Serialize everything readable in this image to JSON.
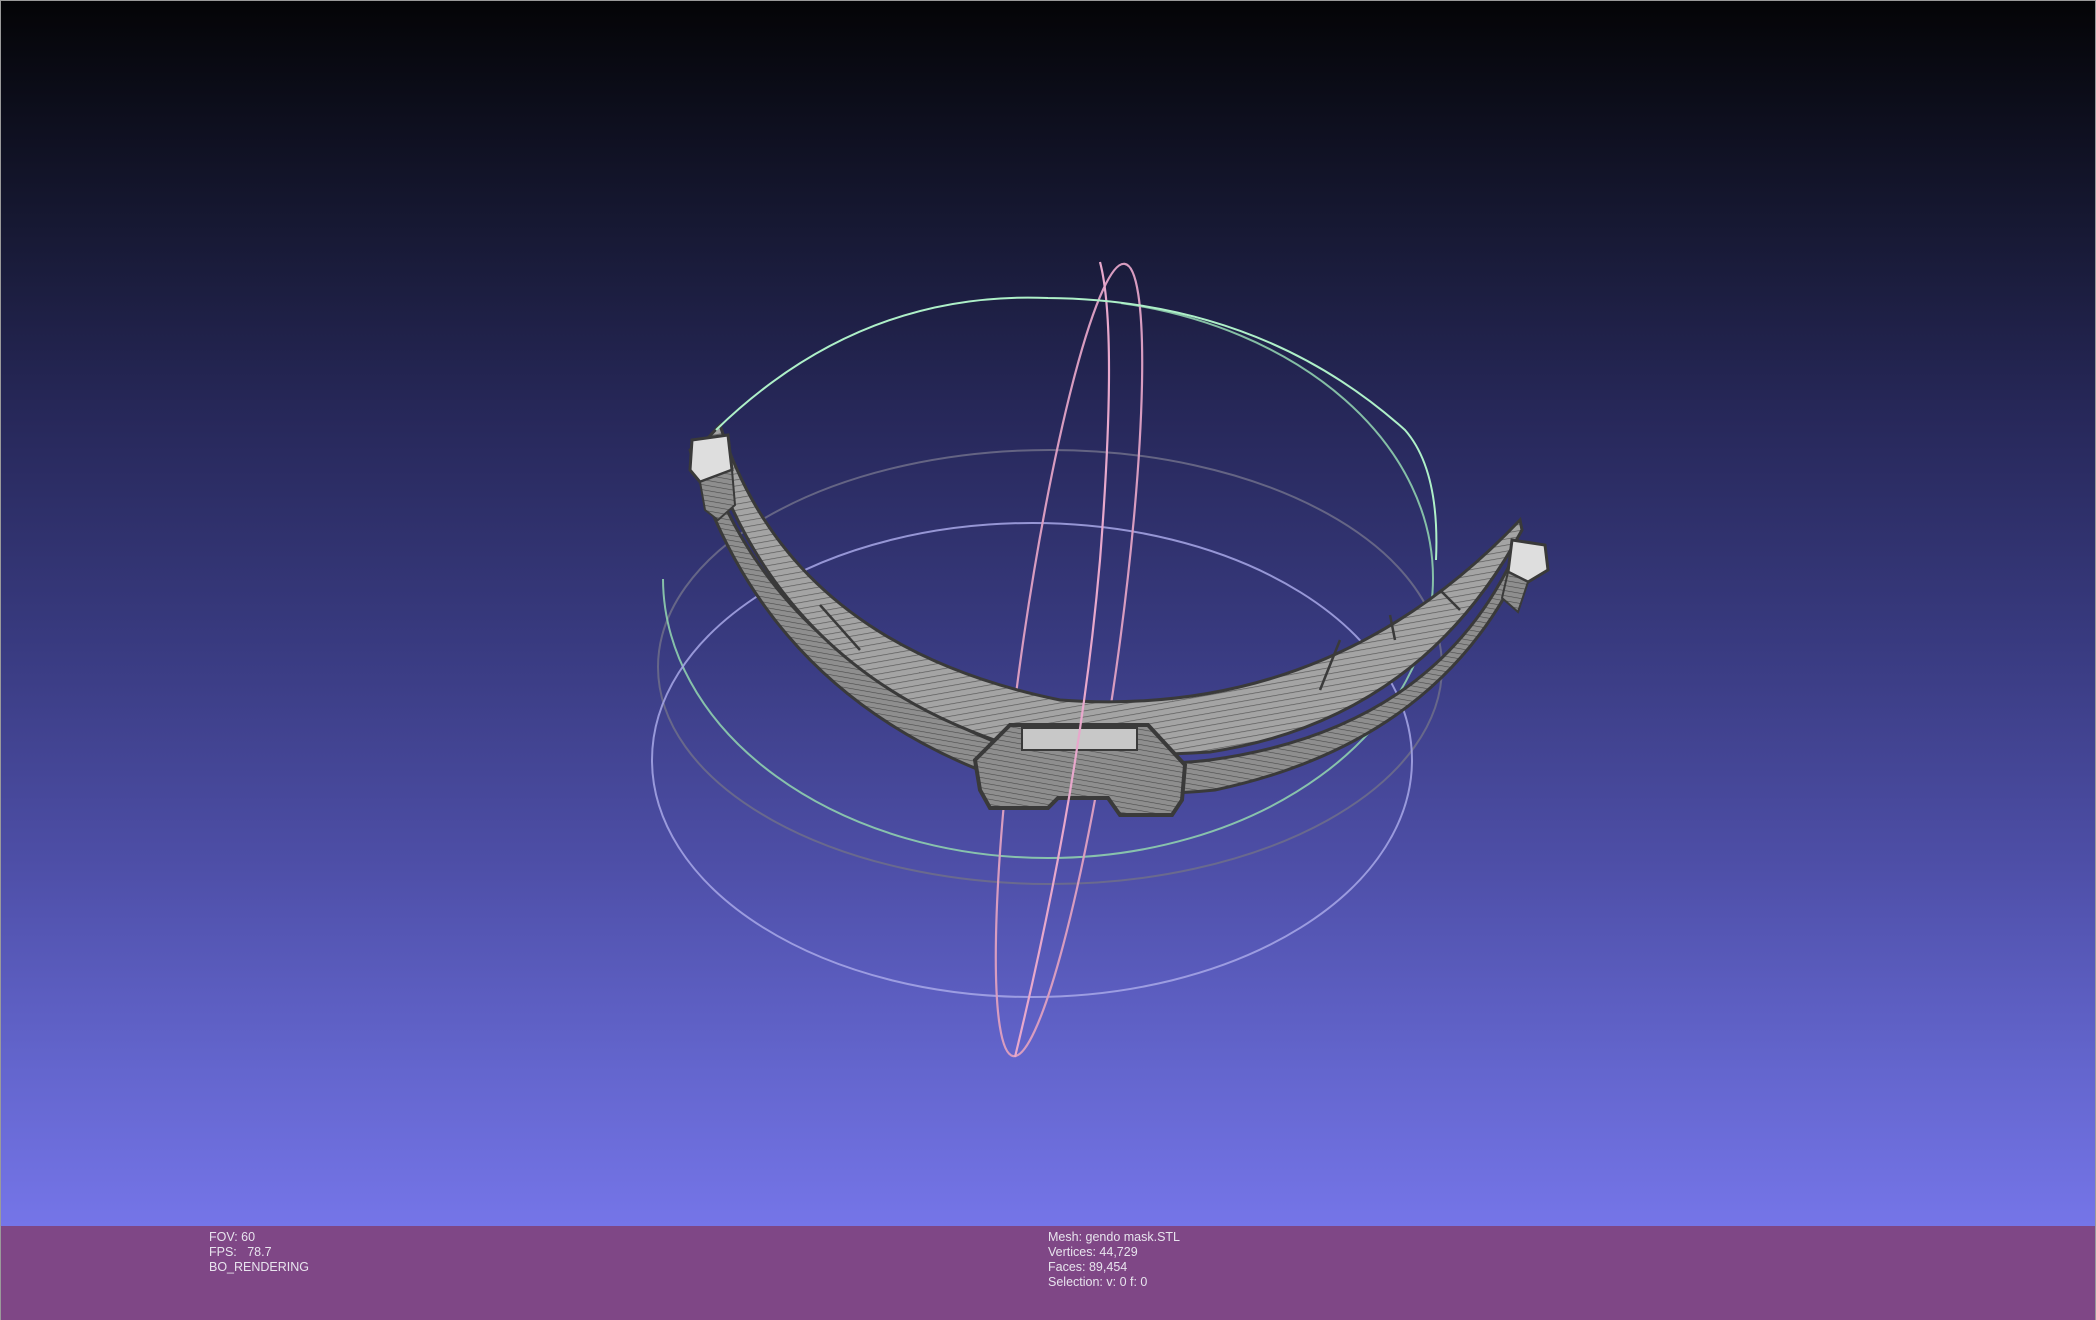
{
  "viewer": {
    "colors": {
      "gradient_top": "#040406",
      "gradient_bottom": "#7575e8",
      "status_bar": "#7f4786",
      "trackball_x": "#e0a0c8",
      "trackball_y": "#a8e8c0",
      "trackball_z": "#b0b0ff",
      "mesh_fill": "#9c9c9c",
      "mesh_edge": "#3a3a3a"
    },
    "objects": [
      "trackball-gizmo",
      "mesh-arc"
    ]
  },
  "status": {
    "left": {
      "fov": "FOV: 60",
      "fps": "FPS:   78.7",
      "mode": "BO_RENDERING"
    },
    "right": {
      "mesh": "Mesh: gendo mask.STL",
      "vertices": "Vertices: 44,729",
      "faces": "Faces: 89,454",
      "selection": "Selection: v: 0 f: 0"
    }
  }
}
